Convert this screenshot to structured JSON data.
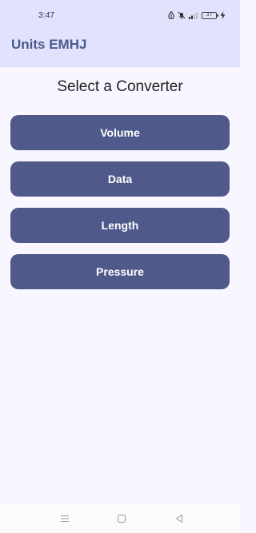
{
  "status_bar": {
    "time": "3:47",
    "battery_level": "37",
    "icons": [
      "data-saver-icon",
      "notifications-off-icon",
      "signal-icon",
      "battery-icon",
      "charging-icon"
    ]
  },
  "app_bar": {
    "title": "Units EMHJ"
  },
  "main": {
    "heading": "Select a Converter",
    "converters": [
      {
        "label": "Volume"
      },
      {
        "label": "Data"
      },
      {
        "label": "Length"
      },
      {
        "label": "Pressure"
      }
    ]
  },
  "nav_bar": {
    "icons": [
      "menu-icon",
      "home-icon",
      "back-icon"
    ]
  },
  "colors": {
    "app_bar_bg": "#e1e2fe",
    "title": "#4c5a8c",
    "button_bg": "#4f5a8b",
    "page_bg": "#f8f6fe"
  }
}
